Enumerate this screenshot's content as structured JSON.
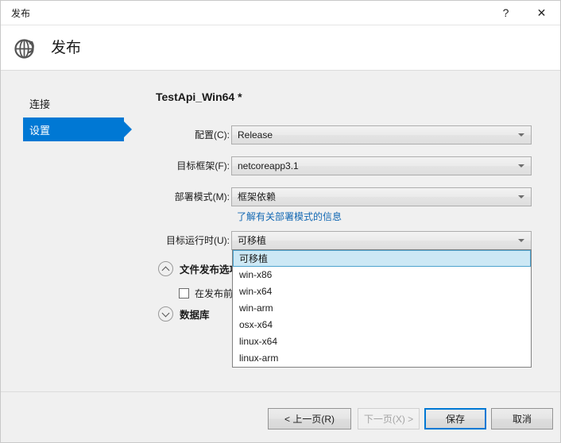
{
  "window": {
    "title": "发布",
    "help_glyph": "?",
    "close_glyph": "✕"
  },
  "header": {
    "title": "发布",
    "icon": "publish-globe-icon"
  },
  "sidebar": {
    "items": [
      {
        "label": "连接",
        "selected": false
      },
      {
        "label": "设置",
        "selected": true
      }
    ]
  },
  "main": {
    "profile_title": "TestApi_Win64 *",
    "fields": [
      {
        "label": "配置(C):",
        "value": "Release"
      },
      {
        "label": "目标框架(F):",
        "value": "netcoreapp3.1"
      },
      {
        "label": "部署模式(M):",
        "value": "框架依赖"
      },
      {
        "label": "目标运行时(U):",
        "value": "可移植"
      }
    ],
    "deploy_link": "了解有关部署模式的信息",
    "runtime_dropdown": {
      "open": true,
      "selected": "可移植",
      "options": [
        "可移植",
        "win-x86",
        "win-x64",
        "win-arm",
        "osx-x64",
        "linux-x64",
        "linux-arm"
      ]
    },
    "sections": [
      {
        "title": "文件发布选项",
        "expanded": true
      },
      {
        "title": "数据库",
        "expanded": false
      }
    ],
    "checkbox": {
      "label": "在发布前",
      "checked": false
    }
  },
  "footer": {
    "buttons": [
      {
        "label": "< 上一页(R)",
        "state": "enabled"
      },
      {
        "label": "下一页(X) >",
        "state": "disabled"
      },
      {
        "label": "保存",
        "state": "default"
      },
      {
        "label": "取消",
        "state": "enabled"
      }
    ]
  },
  "colors": {
    "accent": "#0078d4",
    "highlight": "#cce8f5",
    "link": "#1268b3",
    "body_bg": "#f0f0f0"
  }
}
